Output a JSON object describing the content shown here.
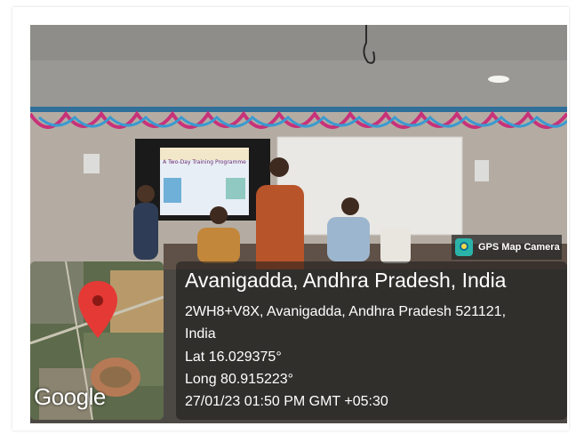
{
  "badge": {
    "label": "GPS Map Camera",
    "icon": "gps-map-camera-icon"
  },
  "location": {
    "title": "Avanigadda, Andhra Pradesh, India",
    "address_line1": "2WH8+V8X, Avanigadda, Andhra Pradesh 521121,",
    "address_line2": "India",
    "lat": "Lat 16.029375°",
    "long": "Long 80.915223°",
    "datetime": "27/01/23 01:50 PM GMT +05:30"
  },
  "map": {
    "logo_text": "Google",
    "pin_icon": "map-pin-icon",
    "pin_color": "#e53935"
  },
  "screen_slide": {
    "title": "A Two-Day Training Programme"
  },
  "colors": {
    "overlay_bg": "#191919",
    "text": "#ffffff",
    "badge_icon": "#2bb3a8"
  }
}
